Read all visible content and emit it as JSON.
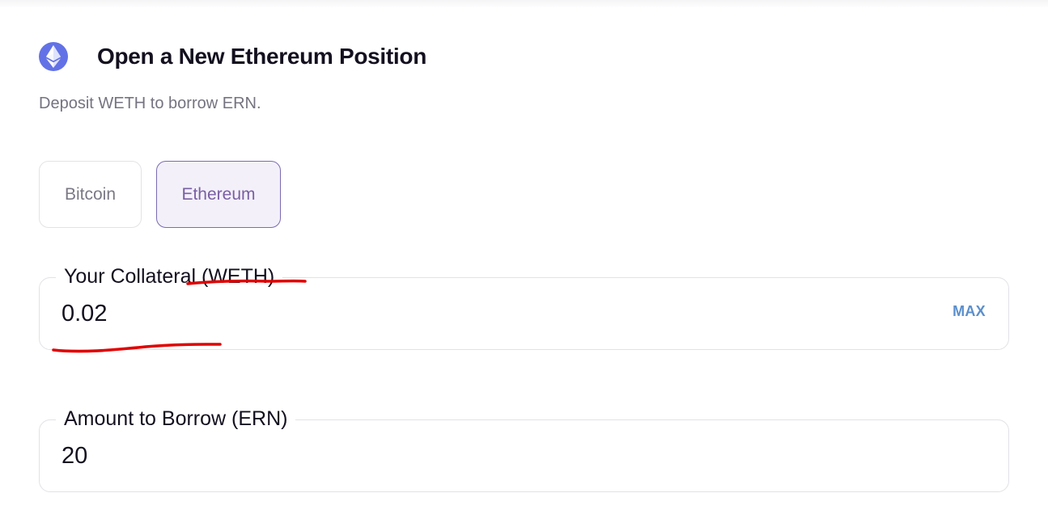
{
  "header": {
    "icon": "ethereum-icon",
    "title": "Open a New Ethereum Position",
    "subtitle": "Deposit WETH to borrow ERN."
  },
  "tabs": [
    {
      "label": "Bitcoin",
      "selected": false
    },
    {
      "label": "Ethereum",
      "selected": true
    }
  ],
  "collateral": {
    "label": "Your Collateral (WETH)",
    "value": "0.02",
    "max_label": "MAX"
  },
  "borrow": {
    "label": "Amount to Borrow (ERN)",
    "value": "20"
  },
  "colors": {
    "accent": "#7a5fa3",
    "eth_logo": "#6272e6",
    "max_link": "#5b8fcc",
    "annotation": "#e00000"
  }
}
